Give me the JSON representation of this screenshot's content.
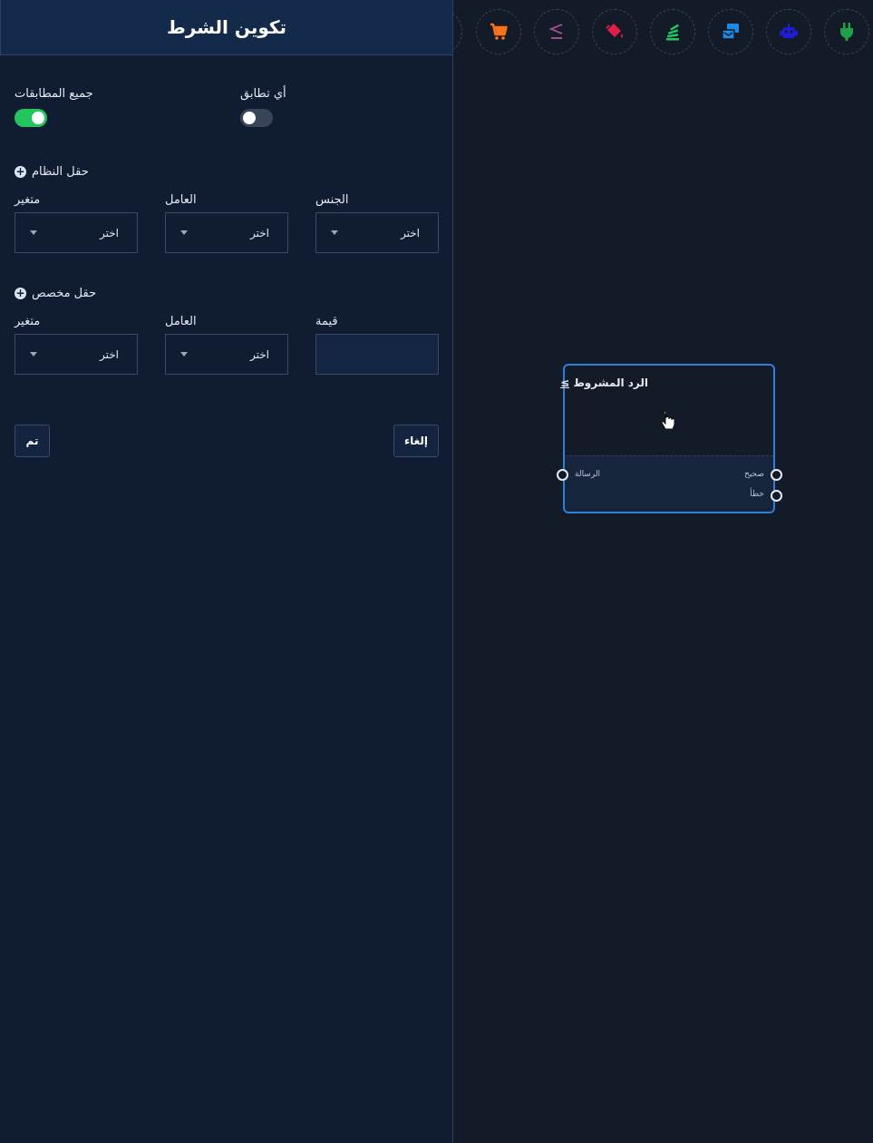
{
  "panel": {
    "title": "تكوين الشرط",
    "any_match_label": "أي تطابق",
    "any_match_on": false,
    "all_match_label": "جميع المطابقات",
    "all_match_on": true,
    "system_field": {
      "heading": "حقل النظام",
      "col1_label": "الجنس",
      "col2_label": "العامل",
      "col3_label": "متغير",
      "col1_value": "اختر",
      "col2_value": "اختر",
      "col3_value": "اختر"
    },
    "custom_field": {
      "heading": "حقل مخصص",
      "col1_label": "قيمة",
      "col2_label": "العامل",
      "col3_label": "متغير",
      "col1_value": "",
      "col2_value": "اختر",
      "col3_value": "اختر"
    },
    "cancel_label": "إلغاء",
    "done_label": "تم"
  },
  "toolbar": {
    "icons": [
      "plug-icon",
      "robot-icon",
      "transfer-icon",
      "stack-icon",
      "paint-bucket-icon",
      "less-equal-icon",
      "cart-icon"
    ],
    "colors": {
      "plug": "#22a047",
      "robot": "#1d1dd6",
      "transfer": "#1e88e5",
      "stack": "#22c55e",
      "bucket": "#e11d48",
      "compare": "#a14c8f",
      "cart": "#f97316"
    }
  },
  "node": {
    "symbol": "≥",
    "title": "الرد المشروط",
    "input_label": "الرسالة",
    "output_true_label": "صحيح",
    "output_false_label": "خطأ"
  }
}
